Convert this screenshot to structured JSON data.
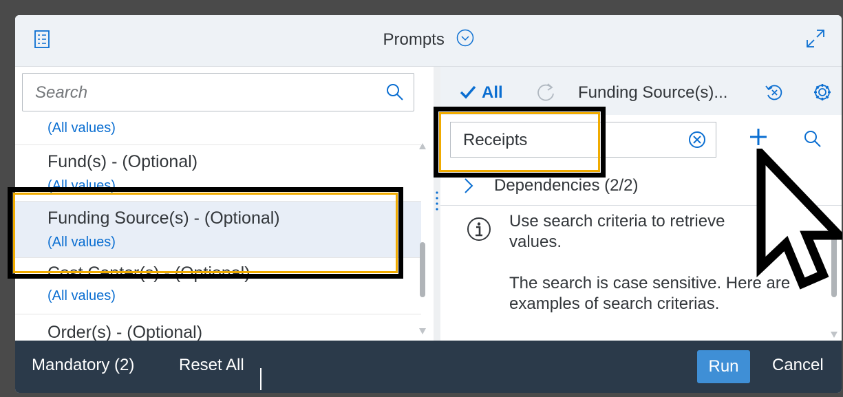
{
  "header": {
    "title": "Prompts"
  },
  "left": {
    "search_placeholder": "Search",
    "items": [
      {
        "title": "",
        "value": "(All values)"
      },
      {
        "title": "Fund(s) - (Optional)",
        "value": "(All values)"
      },
      {
        "title": "Funding Source(s) - (Optional)",
        "value": "(All values)"
      },
      {
        "title": "Cost Center(s) - (Optional)",
        "value": "(All values)"
      },
      {
        "title": "Order(s) - (Optional)",
        "value": ""
      }
    ]
  },
  "right": {
    "all_label": "All",
    "field_label": "Funding Source(s)...",
    "search_value": "Receipts",
    "dependencies_label": "Dependencies (2/2)",
    "info_line1": "Use search criteria to retrieve values.",
    "info_line2": "The search is case sensitive. Here are examples of search criterias."
  },
  "footer": {
    "mandatory_label": "Mandatory (2)",
    "reset_label": "Reset All",
    "run_label": "Run",
    "cancel_label": "Cancel"
  },
  "colors": {
    "accent": "#0a6ed1",
    "highlight": "#f0ab00",
    "footer": "#2b3a4a"
  }
}
